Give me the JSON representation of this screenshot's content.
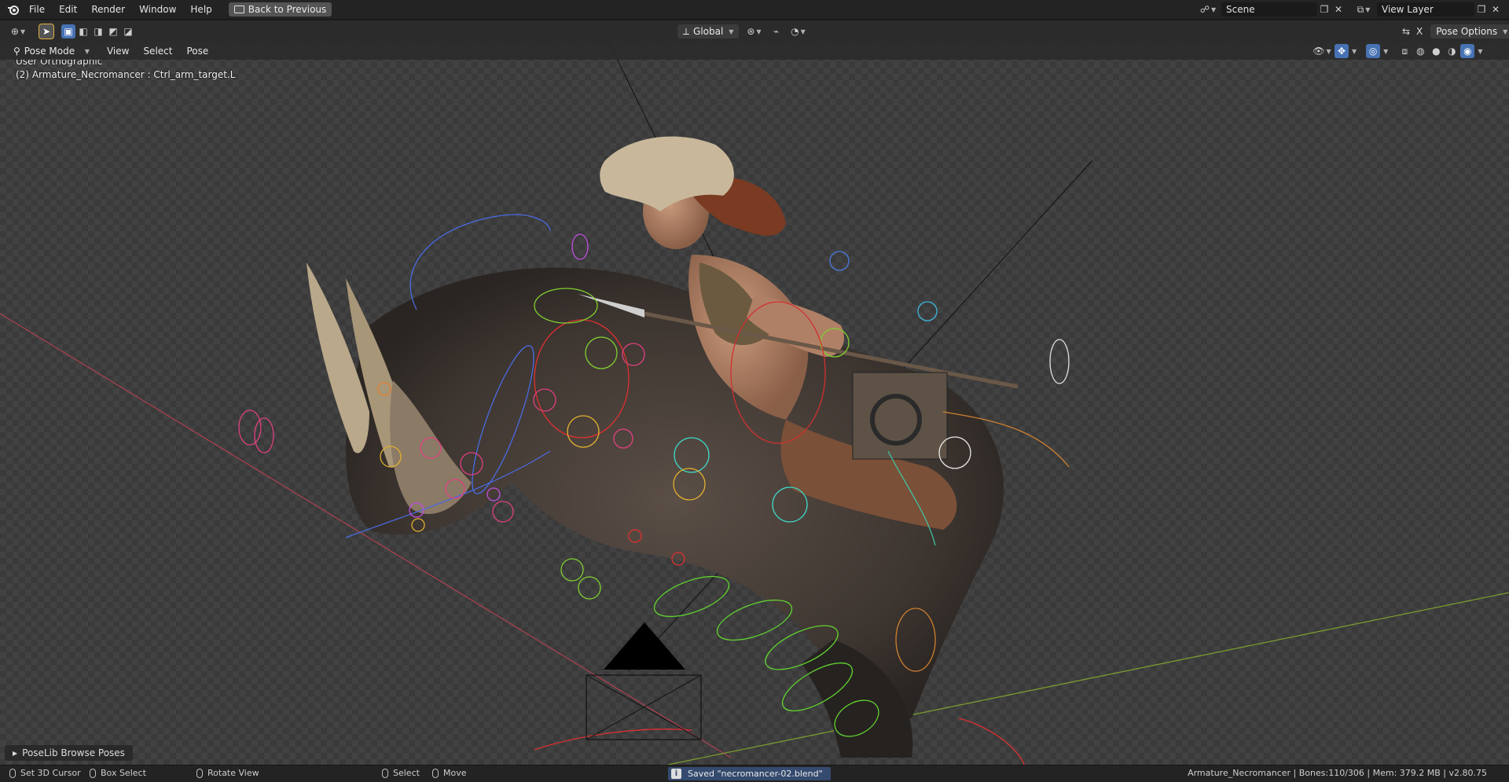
{
  "menu": {
    "items": [
      "File",
      "Edit",
      "Render",
      "Window",
      "Help"
    ],
    "back_to_previous": "Back to Previous"
  },
  "scene": {
    "name": "Scene"
  },
  "view_layer": {
    "name": "View Layer"
  },
  "toolbar": {
    "transform_orientation": "Global",
    "pose_options": "Pose Options",
    "x_axis_label": "X"
  },
  "viewport_header": {
    "mode": "Pose Mode",
    "menus": [
      "View",
      "Select",
      "Pose"
    ]
  },
  "viewport": {
    "view_name": "User Orthographic",
    "active_object": "(2) Armature_Necromancer : Ctrl_arm_target.L"
  },
  "poselib": {
    "label": "PoseLib Browse Poses"
  },
  "statusbar": {
    "set_cursor": "Set 3D Cursor",
    "box_select": "Box Select",
    "rotate_view": "Rotate View",
    "select": "Select",
    "move": "Move",
    "saved_message": "Saved \"necromancer-02.blend\"",
    "stats": "Armature_Necromancer | Bones:110/306 | Mem: 379.2 MB | v2.80.75"
  },
  "colors": {
    "accent": "#4772b3",
    "header_bg": "#232323",
    "saved_bg": "#344a6e"
  }
}
